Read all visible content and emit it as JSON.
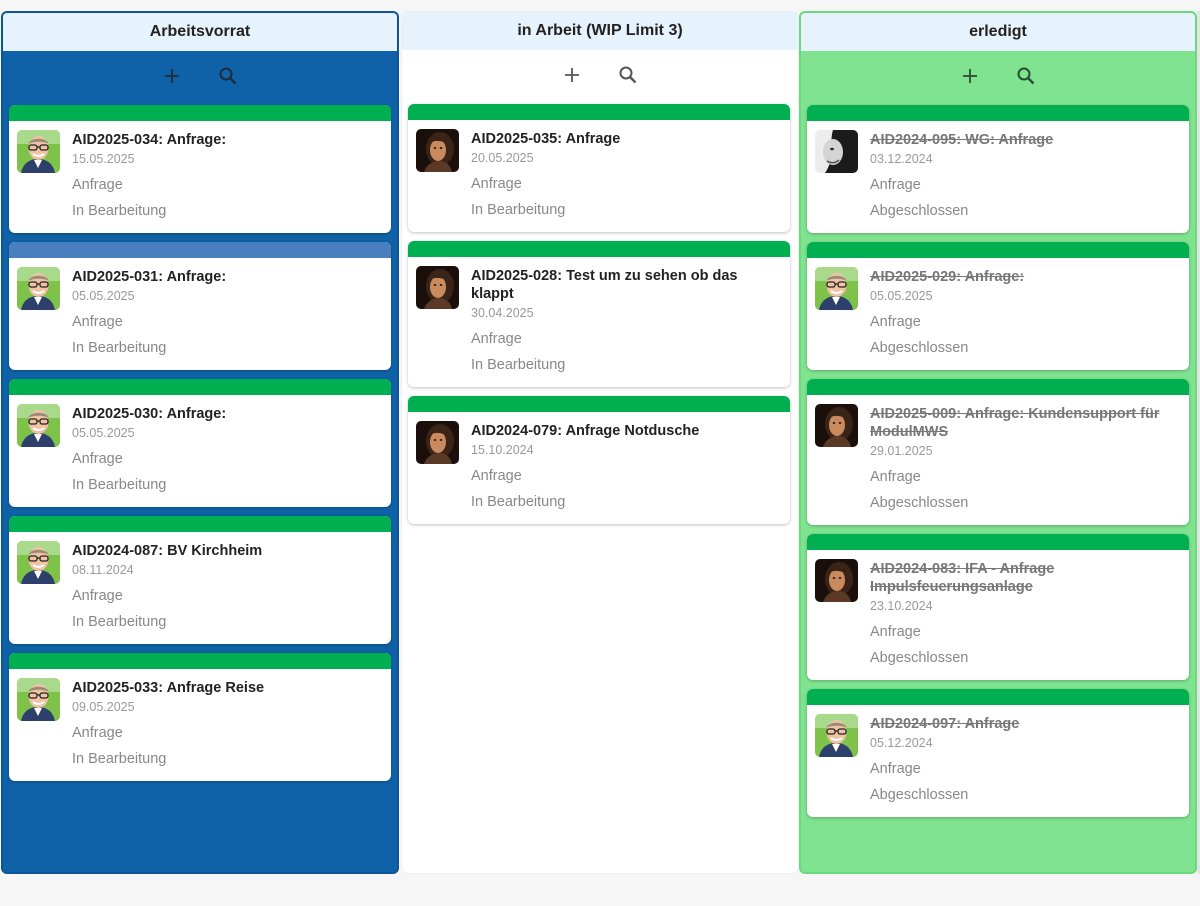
{
  "columns": [
    {
      "title": "Arbeitsvorrat",
      "cards": [
        {
          "title": "AID2025-034: Anfrage:",
          "date": "15.05.2025",
          "type": "Anfrage",
          "status": "In Bearbeitung",
          "bar": "green",
          "avatar": "man-glasses"
        },
        {
          "title": "AID2025-031: Anfrage:",
          "date": "05.05.2025",
          "type": "Anfrage",
          "status": "In Bearbeitung",
          "bar": "blue",
          "avatar": "man-glasses"
        },
        {
          "title": "AID2025-030: Anfrage:",
          "date": "05.05.2025",
          "type": "Anfrage",
          "status": "In Bearbeitung",
          "bar": "green",
          "avatar": "man-glasses"
        },
        {
          "title": "AID2024-087: BV Kirchheim",
          "date": "08.11.2024",
          "type": "Anfrage",
          "status": "In Bearbeitung",
          "bar": "green",
          "avatar": "man-glasses"
        },
        {
          "title": "AID2025-033: Anfrage Reise",
          "date": "09.05.2025",
          "type": "Anfrage",
          "status": "In Bearbeitung",
          "bar": "green",
          "avatar": "man-glasses"
        }
      ]
    },
    {
      "title": "in Arbeit (WIP Limit 3)",
      "cards": [
        {
          "title": "AID2025-035: Anfrage",
          "date": "20.05.2025",
          "type": "Anfrage",
          "status": "In Bearbeitung",
          "bar": "green",
          "avatar": "woman-dark"
        },
        {
          "title": "AID2025-028: Test um zu sehen ob das klappt",
          "date": "30.04.2025",
          "type": "Anfrage",
          "status": "In Bearbeitung",
          "bar": "green",
          "avatar": "woman-dark"
        },
        {
          "title": "AID2024-079: Anfrage Notdusche",
          "date": "15.10.2024",
          "type": "Anfrage",
          "status": "In Bearbeitung",
          "bar": "green",
          "avatar": "woman-dark"
        }
      ]
    },
    {
      "title": "erledigt",
      "cards": [
        {
          "title": "AID2024-095: WG: Anfrage",
          "date": "03.12.2024",
          "type": "Anfrage",
          "status": "Abgeschlossen",
          "bar": "green",
          "avatar": "man-bw",
          "done": true
        },
        {
          "title": "AID2025-029: Anfrage:",
          "date": "05.05.2025",
          "type": "Anfrage",
          "status": "Abgeschlossen",
          "bar": "green",
          "avatar": "man-glasses",
          "done": true
        },
        {
          "title": "AID2025-009: Anfrage: Kundensupport für ModulMWS",
          "date": "29.01.2025",
          "type": "Anfrage",
          "status": "Abgeschlossen",
          "bar": "green",
          "avatar": "woman-dark",
          "done": true
        },
        {
          "title": "AID2024-083: IFA - Anfrage Impulsfeuerungsanlage",
          "date": "23.10.2024",
          "type": "Anfrage",
          "status": "Abgeschlossen",
          "bar": "green",
          "avatar": "woman-dark",
          "done": true
        },
        {
          "title": "AID2024-097: Anfrage",
          "date": "05.12.2024",
          "type": "Anfrage",
          "status": "Abgeschlossen",
          "bar": "green",
          "avatar": "man-glasses",
          "done": true
        }
      ]
    }
  ],
  "colors": {
    "bar_green": "#00b050",
    "bar_blue": "#4a7fbf",
    "col_backlog": "#0f62a7",
    "col_done": "#7fe38f"
  },
  "icons": {
    "add": "plus-icon",
    "search": "search-icon"
  }
}
